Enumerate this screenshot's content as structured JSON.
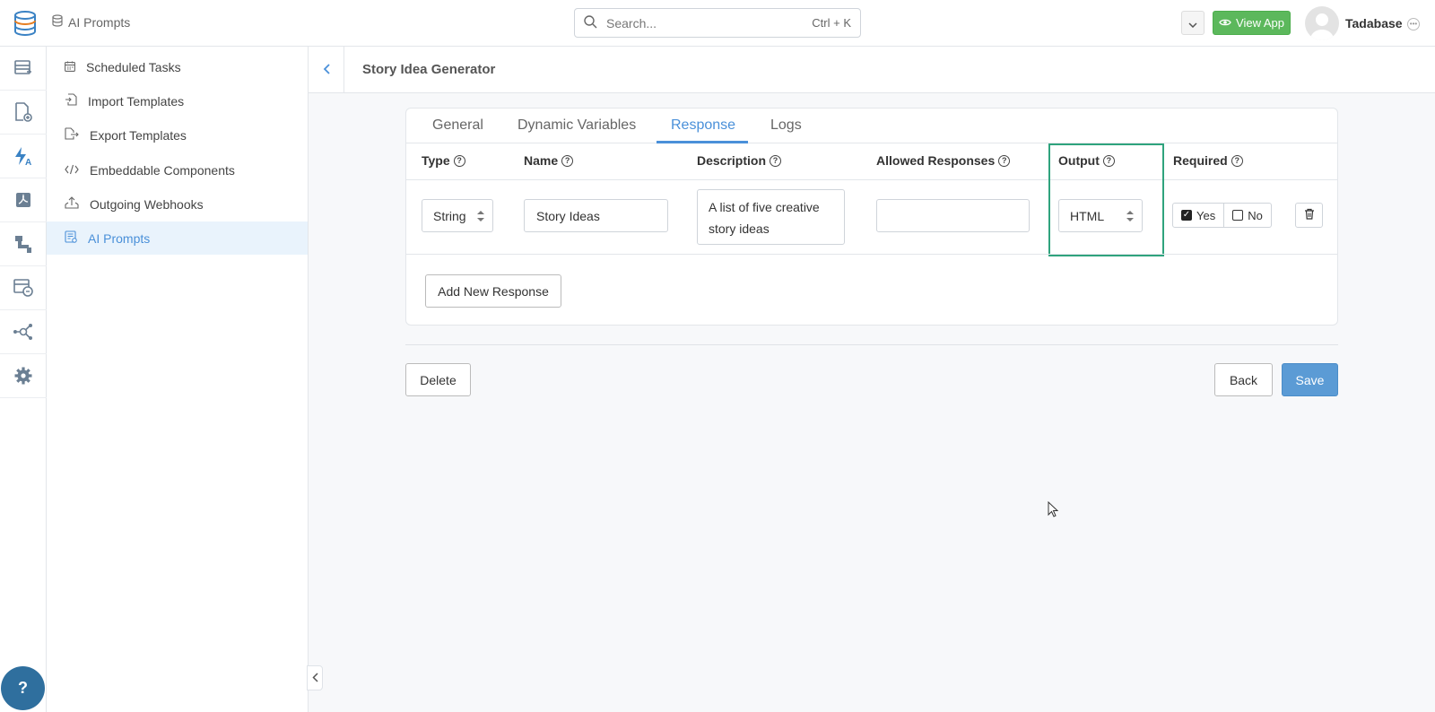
{
  "app": {
    "breadcrumb": "AI Prompts",
    "search_placeholder": "Search...",
    "search_shortcut": "Ctrl + K",
    "view_app_label": "View App",
    "username": "Tadabase"
  },
  "rail": {
    "icons": [
      "data-table-icon",
      "file-add-icon",
      "automation-icon",
      "pdf-icon",
      "pipes-icon",
      "data-sync-icon",
      "network-icon",
      "settings-icon"
    ],
    "help_label": "?"
  },
  "menu": {
    "items": [
      {
        "label": "Scheduled Tasks",
        "icon": "calendar-icon"
      },
      {
        "label": "Import Templates",
        "icon": "import-icon"
      },
      {
        "label": "Export Templates",
        "icon": "export-icon"
      },
      {
        "label": "Embeddable Components",
        "icon": "code-icon"
      },
      {
        "label": "Outgoing Webhooks",
        "icon": "webhook-icon"
      },
      {
        "label": "AI Prompts",
        "icon": "ai-prompt-icon",
        "active": true
      }
    ]
  },
  "page": {
    "title": "Story Idea Generator"
  },
  "tabs": [
    {
      "label": "General"
    },
    {
      "label": "Dynamic Variables"
    },
    {
      "label": "Response",
      "active": true
    },
    {
      "label": "Logs"
    }
  ],
  "table": {
    "headers": {
      "type": "Type",
      "name": "Name",
      "description": "Description",
      "allowed": "Allowed Responses",
      "output": "Output",
      "required": "Required"
    },
    "row": {
      "type": "String",
      "name": "Story Ideas",
      "description": "A list of five creative story ideas",
      "allowed": "",
      "output": "HTML",
      "required_yes": "Yes",
      "required_no": "No",
      "required_value": "Yes"
    }
  },
  "buttons": {
    "add_response": "Add New Response",
    "delete": "Delete",
    "back": "Back",
    "save": "Save"
  },
  "colors": {
    "accent": "#4a90d9",
    "highlight": "#2fa37d",
    "view_app": "#5cb85c",
    "save": "#5b9bd5"
  }
}
